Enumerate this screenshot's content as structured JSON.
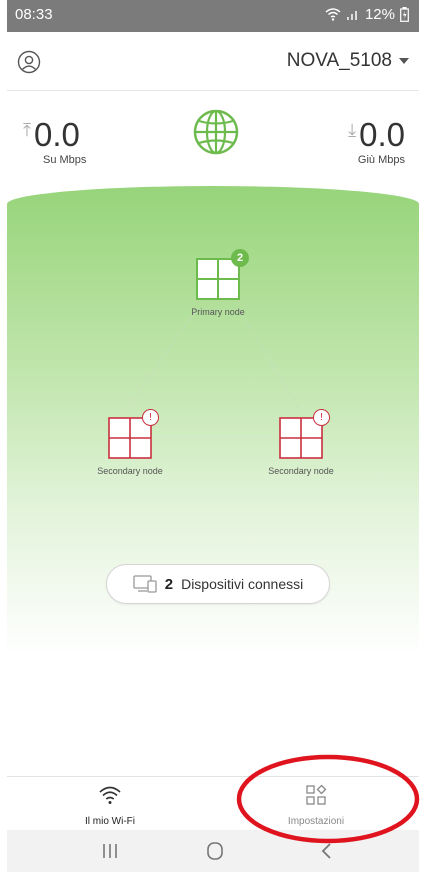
{
  "status_bar": {
    "time": "08:33",
    "battery": "12%"
  },
  "header": {
    "network_name": "NOVA_5108"
  },
  "speed": {
    "upload_value": "0.0",
    "upload_unit": "Su Mbps",
    "download_value": "0.0",
    "download_unit": "Giù Mbps"
  },
  "nodes": {
    "primary": {
      "label": "Primary node",
      "badge": "2"
    },
    "secondary_left": {
      "label": "Secondary node",
      "badge": "!"
    },
    "secondary_right": {
      "label": "Secondary node",
      "badge": "!"
    }
  },
  "devices": {
    "count": "2",
    "label": "Dispositivi connessi"
  },
  "bottom_nav": {
    "wifi_label": "Il mio Wi-Fi",
    "settings_label": "Impostazioni"
  },
  "colors": {
    "accent_green": "#6dbb4c",
    "alert_red": "#c9303f",
    "annotation_red": "#e0141e"
  },
  "icons": [
    "user-icon",
    "globe-icon",
    "upload-arrow-icon",
    "download-arrow-icon",
    "node-icon",
    "devices-icon",
    "wifi-icon",
    "settings-icon",
    "recents-icon",
    "home-icon",
    "back-icon"
  ]
}
